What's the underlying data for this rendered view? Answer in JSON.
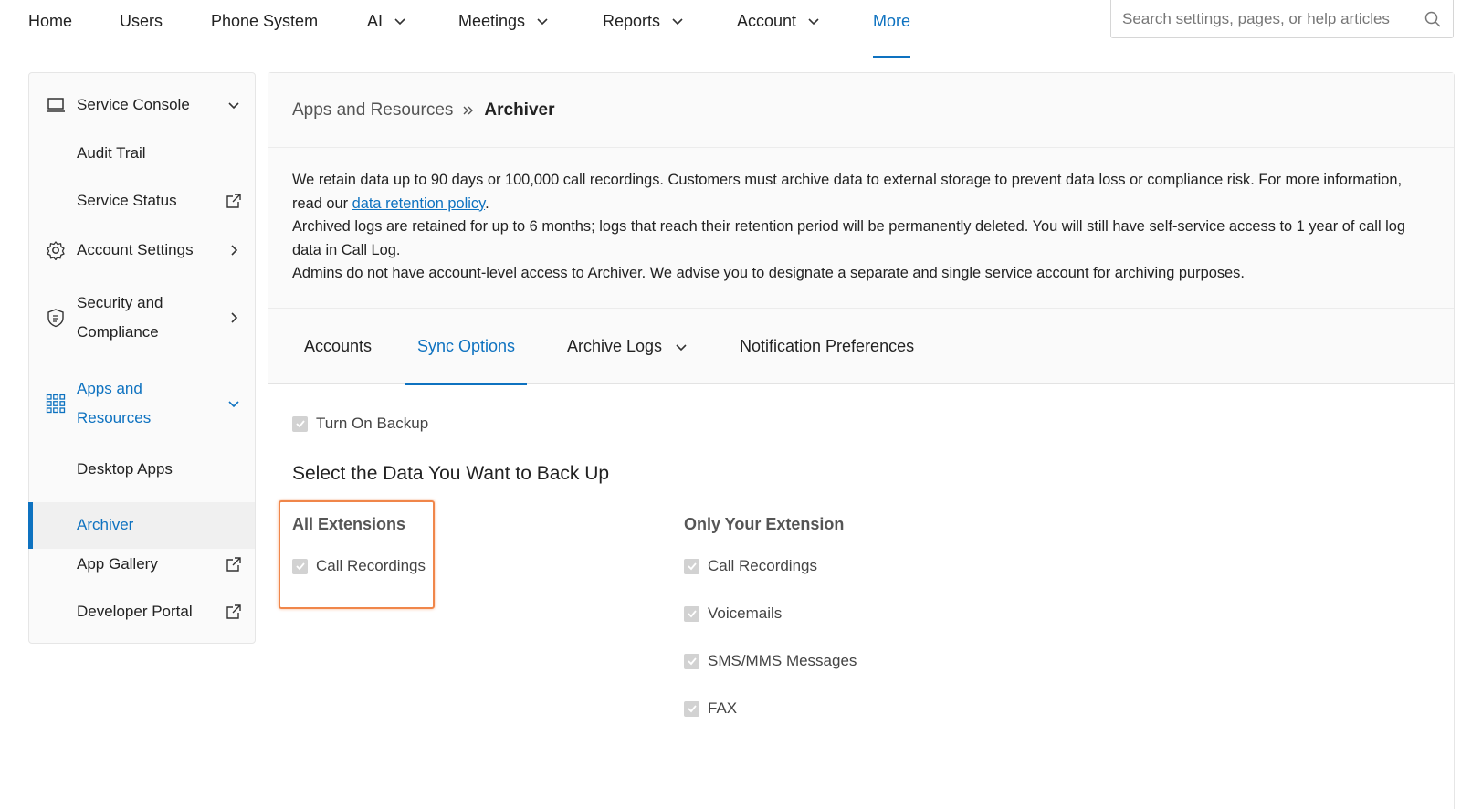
{
  "topnav": {
    "items": [
      {
        "label": "Home"
      },
      {
        "label": "Users"
      },
      {
        "label": "Phone System"
      },
      {
        "label": "AI"
      },
      {
        "label": "Meetings"
      },
      {
        "label": "Reports"
      },
      {
        "label": "Account"
      },
      {
        "label": "More"
      }
    ],
    "active": "More",
    "search_placeholder": "Search settings, pages, or help articles"
  },
  "sidebar": {
    "items": [
      {
        "label": "Service Console",
        "icon": "laptop-icon",
        "right_icon": "chevron-down-icon"
      },
      {
        "label": "Audit Trail"
      },
      {
        "label": "Service Status",
        "right_icon": "external-link-icon"
      },
      {
        "label": "Account Settings",
        "icon": "gear-icon",
        "right_icon": "chevron-right-icon"
      },
      {
        "label_line1": "Security and",
        "label_line2": "Compliance",
        "icon": "shield-icon",
        "right_icon": "chevron-right-icon"
      },
      {
        "label_line1": "Apps and",
        "label_line2": "Resources",
        "icon": "apps-grid-icon",
        "right_icon": "chevron-down-icon"
      },
      {
        "label": "Desktop Apps"
      },
      {
        "label": "Archiver",
        "selected": true
      },
      {
        "label": "App Gallery",
        "right_icon": "external-link-icon"
      },
      {
        "label": "Developer Portal",
        "right_icon": "external-link-icon"
      }
    ]
  },
  "breadcrumb": {
    "parent": "Apps and Resources",
    "current": "Archiver"
  },
  "info": {
    "p1_before": "We retain data up to 90 days or 100,000 call recordings. Customers must archive data to external storage to prevent data loss or compliance risk. For more information, read our ",
    "p1_link": "data retention policy",
    "p1_after": ".",
    "p2": "Archived logs are retained for up to 6 months; logs that reach their retention period will be permanently deleted. You will still have self-service access to 1 year of call log data in Call Log.",
    "p3": "Admins do not have account-level access to Archiver. We advise you to designate a separate and single service account for archiving purposes."
  },
  "tabs": [
    {
      "label": "Accounts"
    },
    {
      "label": "Sync Options"
    },
    {
      "label": "Archive Logs"
    },
    {
      "label": "Notification Preferences"
    }
  ],
  "active_tab": "Sync Options",
  "sync": {
    "turn_on_backup": "Turn On Backup",
    "section_title": "Select the Data You Want to Back Up",
    "all_extensions": {
      "title": "All Extensions",
      "options": [
        "Call Recordings"
      ]
    },
    "only_your_extension": {
      "title": "Only Your Extension",
      "options": [
        "Call Recordings",
        "Voicemails",
        "SMS/MMS Messages",
        "FAX"
      ]
    }
  },
  "colors": {
    "accent": "#0e72c0",
    "highlight": "#f0864a",
    "checkbox_disabled": "#d2d2d2"
  }
}
